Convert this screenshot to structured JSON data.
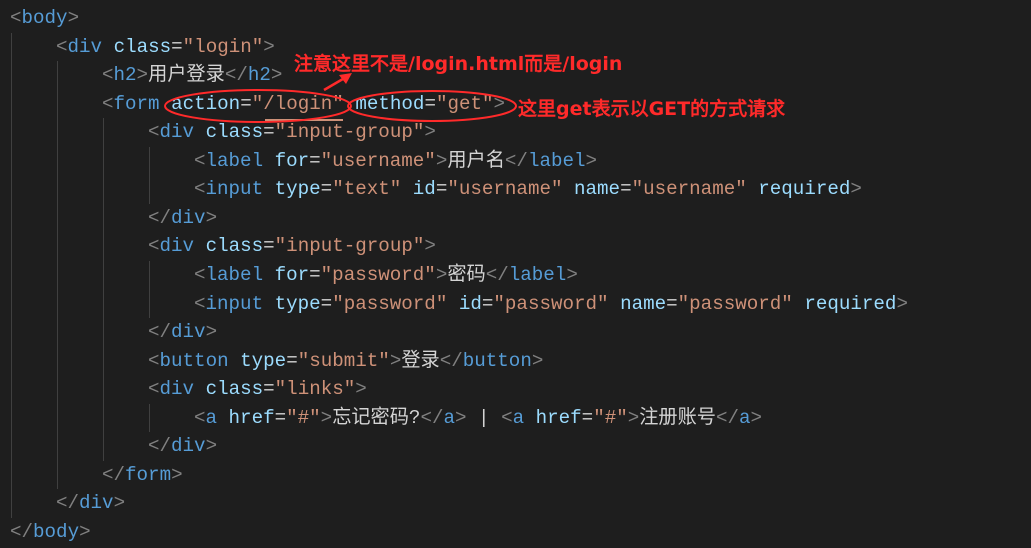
{
  "code_lines": [
    {
      "indent": 0,
      "tokens": [
        [
          "b",
          "<"
        ],
        [
          "tag",
          "body"
        ],
        [
          "b",
          ">"
        ]
      ]
    },
    {
      "indent": 1,
      "tokens": [
        [
          "b",
          "<"
        ],
        [
          "tag",
          "div"
        ],
        [
          "txt",
          " "
        ],
        [
          "attr",
          "class"
        ],
        [
          "eq",
          "="
        ],
        [
          "str",
          "\"login\""
        ],
        [
          "b",
          ">"
        ]
      ]
    },
    {
      "indent": 2,
      "tokens": [
        [
          "b",
          "<"
        ],
        [
          "tag",
          "h2"
        ],
        [
          "b",
          ">"
        ],
        [
          "txt",
          "用户登录"
        ],
        [
          "b",
          "</"
        ],
        [
          "tag",
          "h2"
        ],
        [
          "b",
          ">"
        ]
      ]
    },
    {
      "indent": 2,
      "tokens": [
        [
          "b",
          "<"
        ],
        [
          "tag",
          "form"
        ],
        [
          "txt",
          " "
        ],
        [
          "attr",
          "action"
        ],
        [
          "eq",
          "="
        ],
        [
          "str",
          "\"/login\""
        ],
        [
          "txt",
          " "
        ],
        [
          "attr",
          "method"
        ],
        [
          "eq",
          "="
        ],
        [
          "str",
          "\"get\""
        ],
        [
          "b",
          ">"
        ]
      ]
    },
    {
      "indent": 3,
      "tokens": [
        [
          "b",
          "<"
        ],
        [
          "tag",
          "div"
        ],
        [
          "txt",
          " "
        ],
        [
          "attr",
          "class"
        ],
        [
          "eq",
          "="
        ],
        [
          "str",
          "\"input-group\""
        ],
        [
          "b",
          ">"
        ]
      ]
    },
    {
      "indent": 4,
      "tokens": [
        [
          "b",
          "<"
        ],
        [
          "tag",
          "label"
        ],
        [
          "txt",
          " "
        ],
        [
          "attr",
          "for"
        ],
        [
          "eq",
          "="
        ],
        [
          "str",
          "\"username\""
        ],
        [
          "b",
          ">"
        ],
        [
          "txt",
          "用户名"
        ],
        [
          "b",
          "</"
        ],
        [
          "tag",
          "label"
        ],
        [
          "b",
          ">"
        ]
      ]
    },
    {
      "indent": 4,
      "tokens": [
        [
          "b",
          "<"
        ],
        [
          "tag",
          "input"
        ],
        [
          "txt",
          " "
        ],
        [
          "attr",
          "type"
        ],
        [
          "eq",
          "="
        ],
        [
          "str",
          "\"text\""
        ],
        [
          "txt",
          " "
        ],
        [
          "attr",
          "id"
        ],
        [
          "eq",
          "="
        ],
        [
          "str",
          "\"username\""
        ],
        [
          "txt",
          " "
        ],
        [
          "attr",
          "name"
        ],
        [
          "eq",
          "="
        ],
        [
          "str",
          "\"username\""
        ],
        [
          "txt",
          " "
        ],
        [
          "attr",
          "required"
        ],
        [
          "b",
          ">"
        ]
      ]
    },
    {
      "indent": 3,
      "tokens": [
        [
          "b",
          "</"
        ],
        [
          "tag",
          "div"
        ],
        [
          "b",
          ">"
        ]
      ]
    },
    {
      "indent": 3,
      "tokens": [
        [
          "b",
          "<"
        ],
        [
          "tag",
          "div"
        ],
        [
          "txt",
          " "
        ],
        [
          "attr",
          "class"
        ],
        [
          "eq",
          "="
        ],
        [
          "str",
          "\"input-group\""
        ],
        [
          "b",
          ">"
        ]
      ]
    },
    {
      "indent": 4,
      "tokens": [
        [
          "b",
          "<"
        ],
        [
          "tag",
          "label"
        ],
        [
          "txt",
          " "
        ],
        [
          "attr",
          "for"
        ],
        [
          "eq",
          "="
        ],
        [
          "str",
          "\"password\""
        ],
        [
          "b",
          ">"
        ],
        [
          "txt",
          "密码"
        ],
        [
          "b",
          "</"
        ],
        [
          "tag",
          "label"
        ],
        [
          "b",
          ">"
        ]
      ]
    },
    {
      "indent": 4,
      "tokens": [
        [
          "b",
          "<"
        ],
        [
          "tag",
          "input"
        ],
        [
          "txt",
          " "
        ],
        [
          "attr",
          "type"
        ],
        [
          "eq",
          "="
        ],
        [
          "str",
          "\"password\""
        ],
        [
          "txt",
          " "
        ],
        [
          "attr",
          "id"
        ],
        [
          "eq",
          "="
        ],
        [
          "str",
          "\"password\""
        ],
        [
          "txt",
          " "
        ],
        [
          "attr",
          "name"
        ],
        [
          "eq",
          "="
        ],
        [
          "str",
          "\"password\""
        ],
        [
          "txt",
          " "
        ],
        [
          "attr",
          "required"
        ],
        [
          "b",
          ">"
        ]
      ]
    },
    {
      "indent": 3,
      "tokens": [
        [
          "b",
          "</"
        ],
        [
          "tag",
          "div"
        ],
        [
          "b",
          ">"
        ]
      ]
    },
    {
      "indent": 3,
      "tokens": [
        [
          "b",
          "<"
        ],
        [
          "tag",
          "button"
        ],
        [
          "txt",
          " "
        ],
        [
          "attr",
          "type"
        ],
        [
          "eq",
          "="
        ],
        [
          "str",
          "\"submit\""
        ],
        [
          "b",
          ">"
        ],
        [
          "txt",
          "登录"
        ],
        [
          "b",
          "</"
        ],
        [
          "tag",
          "button"
        ],
        [
          "b",
          ">"
        ]
      ]
    },
    {
      "indent": 3,
      "tokens": [
        [
          "b",
          "<"
        ],
        [
          "tag",
          "div"
        ],
        [
          "txt",
          " "
        ],
        [
          "attr",
          "class"
        ],
        [
          "eq",
          "="
        ],
        [
          "str",
          "\"links\""
        ],
        [
          "b",
          ">"
        ]
      ]
    },
    {
      "indent": 4,
      "tokens": [
        [
          "b",
          "<"
        ],
        [
          "tag",
          "a"
        ],
        [
          "txt",
          " "
        ],
        [
          "attr",
          "href"
        ],
        [
          "eq",
          "="
        ],
        [
          "str",
          "\"#\""
        ],
        [
          "b",
          ">"
        ],
        [
          "txt",
          "忘记密码?"
        ],
        [
          "b",
          "</"
        ],
        [
          "tag",
          "a"
        ],
        [
          "b",
          ">"
        ],
        [
          "txt",
          " | "
        ],
        [
          "b",
          "<"
        ],
        [
          "tag",
          "a"
        ],
        [
          "txt",
          " "
        ],
        [
          "attr",
          "href"
        ],
        [
          "eq",
          "="
        ],
        [
          "str",
          "\"#\""
        ],
        [
          "b",
          ">"
        ],
        [
          "txt",
          "注册账号"
        ],
        [
          "b",
          "</"
        ],
        [
          "tag",
          "a"
        ],
        [
          "b",
          ">"
        ]
      ]
    },
    {
      "indent": 3,
      "tokens": [
        [
          "b",
          "</"
        ],
        [
          "tag",
          "div"
        ],
        [
          "b",
          ">"
        ]
      ]
    },
    {
      "indent": 2,
      "tokens": [
        [
          "b",
          "</"
        ],
        [
          "tag",
          "form"
        ],
        [
          "b",
          ">"
        ]
      ]
    },
    {
      "indent": 1,
      "tokens": [
        [
          "b",
          "</"
        ],
        [
          "tag",
          "div"
        ],
        [
          "b",
          ">"
        ]
      ]
    },
    {
      "indent": 0,
      "tokens": [
        [
          "b",
          "</"
        ],
        [
          "tag",
          "body"
        ],
        [
          "b",
          ">"
        ]
      ]
    }
  ],
  "annotations": {
    "note_action": "注意这里不是/login.html而是/login",
    "note_method": "这里get表示以GET的方式请求",
    "color": "#ff2a2a"
  }
}
